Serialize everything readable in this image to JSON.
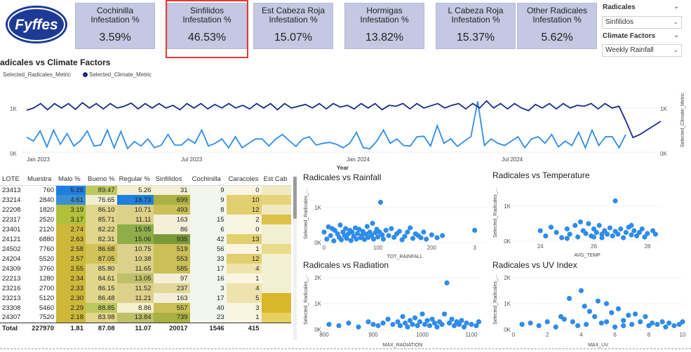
{
  "logo": {
    "text": "Fyffes"
  },
  "kpis": [
    {
      "title": "Cochinilla Infestation %",
      "value": "3.59%"
    },
    {
      "title": "Sinfilidos Infestation %",
      "value": "46.53%"
    },
    {
      "title": "Est Cabeza Roja Infestation %",
      "value": "15.07%"
    },
    {
      "title": "Hormigas Infestation %",
      "value": "13.82%"
    },
    {
      "title": "L Cabeza Roja Infestation %",
      "value": "15.37%"
    },
    {
      "title": "Other Radicales Infestation %",
      "value": "5.62%"
    }
  ],
  "slicers": {
    "radicales": {
      "label": "Radicales",
      "value": "Sinfilidos"
    },
    "climate": {
      "label": "Climate Factors",
      "value": "Weekly Rainfall"
    }
  },
  "line_chart": {
    "title": "adicales vs Climate Factors",
    "legend": [
      "Selected_Radicales_Metric",
      "Selected_Climate_Metric"
    ],
    "x_axis_label": "Year",
    "y_left_ticks": [
      "1K",
      "0K"
    ],
    "y_right_ticks": [
      "1K",
      "0K"
    ],
    "y_right_label": "Selected_Climate_Metric",
    "x_ticks": [
      "Jan 2023",
      "Jul 2023",
      "Jan 2024",
      "Jul 2024"
    ],
    "colors": {
      "radicales": "#2f8ce8",
      "climate": "#1a2a8a"
    }
  },
  "table": {
    "headers": [
      "LOTE",
      "Muestra",
      "Malo %",
      "Bueno %",
      "Regular %",
      "Sinfilidos",
      "Cochinilla",
      "Caracoles",
      "Est Cab"
    ],
    "rows": [
      [
        "23413",
        "760",
        "5.26",
        "89.47",
        "5.26",
        "31",
        "9",
        "0",
        ""
      ],
      [
        "23214",
        "2840",
        "4.61",
        "76.65",
        "18.73",
        "699",
        "9",
        "10",
        ""
      ],
      [
        "22208",
        "1820",
        "3.19",
        "86.10",
        "10.71",
        "493",
        "8",
        "12",
        ""
      ],
      [
        "22317",
        "2520",
        "3.17",
        "85.71",
        "11.11",
        "163",
        "15",
        "2",
        ""
      ],
      [
        "23401",
        "2120",
        "2.74",
        "82.22",
        "15.05",
        "86",
        "6",
        "0",
        ""
      ],
      [
        "24121",
        "6880",
        "2.63",
        "82.31",
        "15.06",
        "935",
        "42",
        "13",
        ""
      ],
      [
        "24502",
        "7760",
        "2.58",
        "86.68",
        "10.75",
        "519",
        "56",
        "1",
        ""
      ],
      [
        "24204",
        "5520",
        "2.57",
        "87.05",
        "10.38",
        "553",
        "33",
        "12",
        ""
      ],
      [
        "24309",
        "3760",
        "2.55",
        "85.80",
        "11.65",
        "585",
        "17",
        "4",
        ""
      ],
      [
        "22213",
        "1280",
        "2.34",
        "84.61",
        "13.05",
        "97",
        "16",
        "1",
        ""
      ],
      [
        "23216",
        "2700",
        "2.33",
        "86.15",
        "11.52",
        "237",
        "3",
        "4",
        ""
      ],
      [
        "23213",
        "5120",
        "2.30",
        "86.48",
        "11.21",
        "163",
        "17",
        "5",
        ""
      ],
      [
        "23308",
        "5460",
        "2.29",
        "88.85",
        "8.86",
        "557",
        "40",
        "3",
        ""
      ],
      [
        "24307",
        "7520",
        "2.18",
        "83.98",
        "13.84",
        "739",
        "23",
        "1",
        ""
      ]
    ],
    "total": [
      "Total",
      "227970",
      "1.81",
      "87.08",
      "11.07",
      "20017",
      "1546",
      "415",
      ""
    ]
  },
  "scatters": [
    {
      "title": "Radicales vs Rainfall",
      "xlabel": "TOT_RAINFALL",
      "ylabel": "Selected_Radicales_...",
      "xticks": [
        "0",
        "100",
        "200",
        "3"
      ],
      "yticks": [
        "1K",
        "0K"
      ]
    },
    {
      "title": "Radicales vs Temperature",
      "xlabel": "AVG_TEMP",
      "ylabel": "Selected_Radicales_...",
      "xticks": [
        "24",
        "26",
        "28"
      ],
      "yticks": [
        "1K",
        "0K"
      ]
    },
    {
      "title": "Radicales vs Radiation",
      "xlabel": "MAX_RADIATION",
      "ylabel": "Selected_Radicales_...",
      "xticks": [
        "800",
        "900",
        "1000",
        "1100"
      ],
      "yticks": [
        "2K",
        "1K",
        "0K"
      ]
    },
    {
      "title": "Radicales vs UV Index",
      "xlabel": "MAX_UV",
      "ylabel": "Selected_Radicales_...",
      "xticks": [
        "0",
        "2",
        "4",
        "6",
        "8",
        "10"
      ],
      "yticks": [
        "2K",
        "1K",
        "0K"
      ]
    }
  ],
  "chart_data": [
    {
      "type": "line",
      "title": "adicales vs Climate Factors",
      "xlabel": "Year",
      "x_range": [
        "Jan 2023",
        "Oct 2024"
      ],
      "series": [
        {
          "name": "Selected_Radicales_Metric",
          "axis": "left",
          "values": [
            340,
            250,
            480,
            120,
            500,
            180,
            420,
            140,
            260,
            480,
            140,
            160,
            500,
            100,
            470,
            80,
            240,
            140,
            300,
            100,
            160,
            400,
            160,
            160,
            300,
            200,
            500,
            140,
            200,
            300,
            100,
            350,
            100,
            200,
            300,
            300,
            140,
            300,
            400,
            260,
            130,
            300,
            350,
            160,
            200,
            220,
            180,
            100,
            200,
            450,
            100,
            80,
            250,
            500,
            200,
            300,
            150,
            140,
            350,
            360,
            140,
            600,
            200,
            300,
            130,
            250,
            350,
            1150,
            150,
            300,
            200,
            150,
            250,
            350,
            100,
            300,
            350,
            200,
            400,
            120,
            250,
            150,
            450,
            100,
            500,
            150,
            350,
            350,
            100,
            400
          ]
        },
        {
          "name": "Selected_Climate_Metric",
          "axis": "right",
          "values": [
            950,
            1000,
            1100,
            960,
            1100,
            1000,
            1100,
            970,
            1120,
            1000,
            1100,
            980,
            1100,
            1000,
            1040,
            1110,
            980,
            1100,
            1000,
            1100,
            1000,
            1060,
            960,
            1100,
            1000,
            1100,
            980,
            1080,
            1000,
            1100,
            1000,
            1060,
            980,
            1100,
            1000,
            1100,
            960,
            1100,
            1000,
            1040,
            1080,
            1000,
            1100,
            980,
            1100,
            1020,
            1060,
            980,
            1100,
            1000,
            1100,
            960,
            1060,
            1040,
            1100,
            980,
            1100,
            1000,
            1050,
            1100,
            1000,
            1060,
            1100,
            980,
            1100,
            1000,
            1160,
            1000,
            1100,
            980,
            1100,
            1000,
            940,
            1080,
            1000,
            1100,
            980,
            1100,
            1000,
            1060,
            1040,
            1100,
            980,
            1100,
            1000,
            1040,
            700,
            330,
            400,
            500,
            600,
            700
          ]
        }
      ]
    },
    {
      "type": "scatter",
      "title": "Radicales vs Rainfall",
      "xlabel": "TOT_RAINFALL",
      "ylabel": "Selected_Radicales_...",
      "xlim": [
        0,
        300
      ],
      "ylim": [
        0,
        1400
      ],
      "points": [
        [
          0,
          300
        ],
        [
          5,
          100
        ],
        [
          8,
          450
        ],
        [
          12,
          200
        ],
        [
          15,
          400
        ],
        [
          18,
          50
        ],
        [
          20,
          350
        ],
        [
          25,
          250
        ],
        [
          28,
          150
        ],
        [
          30,
          500
        ],
        [
          32,
          80
        ],
        [
          35,
          300
        ],
        [
          38,
          200
        ],
        [
          40,
          400
        ],
        [
          42,
          120
        ],
        [
          45,
          250
        ],
        [
          48,
          350
        ],
        [
          50,
          60
        ],
        [
          52,
          300
        ],
        [
          55,
          180
        ],
        [
          58,
          420
        ],
        [
          60,
          100
        ],
        [
          62,
          260
        ],
        [
          65,
          380
        ],
        [
          68,
          140
        ],
        [
          70,
          200
        ],
        [
          72,
          320
        ],
        [
          75,
          90
        ],
        [
          78,
          240
        ],
        [
          80,
          460
        ],
        [
          82,
          150
        ],
        [
          85,
          300
        ],
        [
          88,
          200
        ],
        [
          90,
          550
        ],
        [
          92,
          100
        ],
        [
          95,
          280
        ],
        [
          98,
          380
        ],
        [
          100,
          160
        ],
        [
          103,
          300
        ],
        [
          105,
          1150
        ],
        [
          108,
          220
        ],
        [
          110,
          100
        ],
        [
          115,
          350
        ],
        [
          120,
          200
        ],
        [
          125,
          400
        ],
        [
          130,
          150
        ],
        [
          135,
          250
        ],
        [
          140,
          320
        ],
        [
          145,
          80
        ],
        [
          150,
          180
        ],
        [
          155,
          300
        ],
        [
          160,
          420
        ],
        [
          165,
          120
        ],
        [
          170,
          250
        ],
        [
          175,
          200
        ],
        [
          180,
          140
        ],
        [
          185,
          300
        ],
        [
          190,
          100
        ],
        [
          200,
          220
        ],
        [
          210,
          140
        ],
        [
          220,
          200
        ],
        [
          280,
          350
        ]
      ]
    },
    {
      "type": "scatter",
      "title": "Radicales vs Temperature",
      "xlabel": "AVG_TEMP",
      "ylabel": "Selected_Radicales_...",
      "xlim": [
        23,
        28.5
      ],
      "ylim": [
        0,
        1400
      ],
      "points": [
        [
          24.0,
          300
        ],
        [
          24.2,
          150
        ],
        [
          24.4,
          400
        ],
        [
          24.6,
          250
        ],
        [
          24.8,
          100
        ],
        [
          25.0,
          350
        ],
        [
          25.1,
          200
        ],
        [
          25.3,
          450
        ],
        [
          25.4,
          120
        ],
        [
          25.6,
          300
        ],
        [
          25.7,
          220
        ],
        [
          25.8,
          500
        ],
        [
          25.9,
          150
        ],
        [
          26.0,
          350
        ],
        [
          26.1,
          250
        ],
        [
          26.2,
          450
        ],
        [
          26.3,
          100
        ],
        [
          26.4,
          300
        ],
        [
          26.5,
          200
        ],
        [
          26.6,
          380
        ],
        [
          26.7,
          150
        ],
        [
          26.8,
          280
        ],
        [
          26.9,
          200
        ],
        [
          27.0,
          350
        ],
        [
          27.1,
          100
        ],
        [
          27.2,
          250
        ],
        [
          27.3,
          400
        ],
        [
          27.4,
          180
        ],
        [
          27.5,
          300
        ],
        [
          27.6,
          150
        ],
        [
          27.7,
          250
        ],
        [
          27.8,
          350
        ],
        [
          27.9,
          120
        ],
        [
          28.0,
          220
        ],
        [
          28.2,
          300
        ],
        [
          26.8,
          1150
        ],
        [
          25.5,
          550
        ],
        [
          26.0,
          120
        ],
        [
          26.3,
          200
        ],
        [
          27.4,
          450
        ],
        [
          28.3,
          200
        ],
        [
          25.0,
          80
        ]
      ]
    },
    {
      "type": "scatter",
      "title": "Radicales vs Radiation",
      "xlabel": "MAX_RADIATION",
      "ylabel": "Selected_Radicales_...",
      "xlim": [
        800,
        1120
      ],
      "ylim": [
        0,
        2000
      ],
      "points": [
        [
          810,
          200
        ],
        [
          830,
          150
        ],
        [
          850,
          250
        ],
        [
          870,
          100
        ],
        [
          890,
          300
        ],
        [
          900,
          200
        ],
        [
          910,
          150
        ],
        [
          920,
          250
        ],
        [
          930,
          400
        ],
        [
          940,
          200
        ],
        [
          950,
          300
        ],
        [
          955,
          150
        ],
        [
          960,
          500
        ],
        [
          965,
          250
        ],
        [
          970,
          100
        ],
        [
          975,
          350
        ],
        [
          980,
          200
        ],
        [
          985,
          450
        ],
        [
          990,
          150
        ],
        [
          995,
          300
        ],
        [
          1000,
          600
        ],
        [
          1005,
          200
        ],
        [
          1010,
          350
        ],
        [
          1015,
          150
        ],
        [
          1020,
          400
        ],
        [
          1025,
          250
        ],
        [
          1030,
          100
        ],
        [
          1035,
          300
        ],
        [
          1040,
          200
        ],
        [
          1045,
          600
        ],
        [
          1050,
          1800
        ],
        [
          1055,
          250
        ],
        [
          1060,
          400
        ],
        [
          1065,
          150
        ],
        [
          1070,
          300
        ],
        [
          1075,
          200
        ],
        [
          1080,
          350
        ],
        [
          1085,
          100
        ],
        [
          1090,
          250
        ],
        [
          1100,
          200
        ],
        [
          1110,
          150
        ],
        [
          1115,
          300
        ]
      ]
    },
    {
      "type": "scatter",
      "title": "Radicales vs UV Index",
      "xlabel": "MAX_UV",
      "ylabel": "Selected_Radicales_...",
      "xlim": [
        0,
        10
      ],
      "ylim": [
        0,
        2000
      ],
      "points": [
        [
          0.5,
          200
        ],
        [
          1,
          250
        ],
        [
          1.5,
          150
        ],
        [
          2,
          300
        ],
        [
          2.5,
          100
        ],
        [
          3,
          400
        ],
        [
          3.3,
          1200
        ],
        [
          3.5,
          300
        ],
        [
          3.8,
          150
        ],
        [
          4,
          1500
        ],
        [
          4.2,
          900
        ],
        [
          4.5,
          700
        ],
        [
          4.8,
          500
        ],
        [
          5,
          1100
        ],
        [
          5.2,
          250
        ],
        [
          5.5,
          300
        ],
        [
          5.8,
          650
        ],
        [
          6,
          100
        ],
        [
          6.2,
          800
        ],
        [
          6.5,
          350
        ],
        [
          6.8,
          550
        ],
        [
          7,
          200
        ],
        [
          7.2,
          600
        ],
        [
          7.5,
          300
        ],
        [
          7.8,
          500
        ],
        [
          8,
          150
        ],
        [
          8.2,
          250
        ],
        [
          8.5,
          200
        ],
        [
          8.8,
          300
        ],
        [
          9,
          100
        ],
        [
          9.2,
          250
        ],
        [
          9.5,
          150
        ],
        [
          9.8,
          200
        ],
        [
          10,
          300
        ],
        [
          2.8,
          500
        ],
        [
          5.5,
          1000
        ],
        [
          4.3,
          200
        ],
        [
          6.5,
          150
        ]
      ]
    }
  ]
}
